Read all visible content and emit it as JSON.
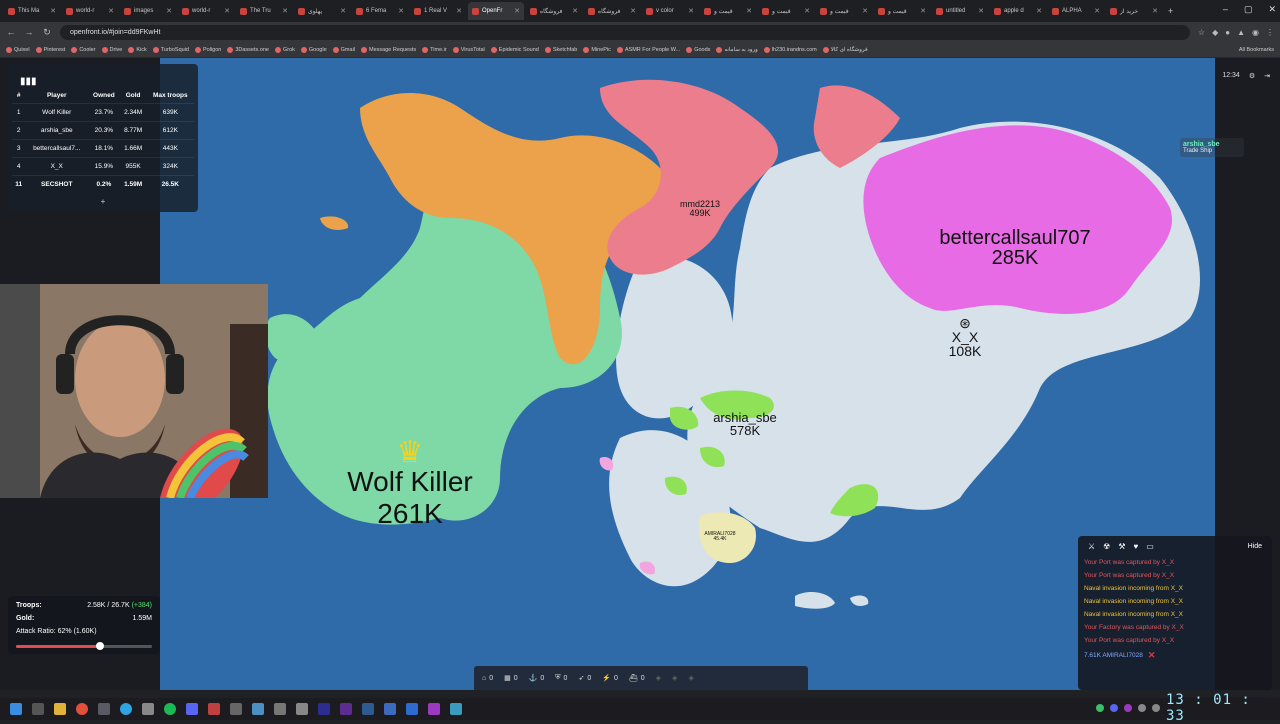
{
  "browser": {
    "tabs": [
      "This Ma",
      "world-r",
      "images",
      "world-r",
      "The Tru",
      "پهلوی",
      "6 Fema",
      "1 Real V",
      "OpenFr",
      "فروشگاه",
      "فروشگاه",
      "v color",
      "قیمت و",
      "قیمت و",
      "قیمت و",
      "قیمت و",
      "untitled",
      "apple d",
      "ALPHA",
      "خرید از"
    ],
    "active_tab_index": 8,
    "url": "openfront.io/#join=dd9FKwHt",
    "bookmarks": [
      "Quixel",
      "Pinterest",
      "Cooler",
      "Drive",
      "Kick",
      "TurboSquid",
      "Poligon",
      "3Dassets.one",
      "Grok",
      "Google",
      "Gmail",
      "Message Requests",
      "Time.ir",
      "VirusTotal",
      "Epidemic Sound",
      "Sketchfab",
      "MinePic",
      "ASMR For People W...",
      "Goods",
      "ورود به سامانه",
      "lh230.irandns.com",
      "فروشگاه ای کالا"
    ],
    "all_bookmarks": "All Bookmarks"
  },
  "leaderboard": {
    "headers": [
      "#",
      "Player",
      "Owned",
      "Gold",
      "Max troops"
    ],
    "rows": [
      [
        "1",
        "Wolf Killer",
        "23.7%",
        "2.34M",
        "639K"
      ],
      [
        "2",
        "arshia_sbe",
        "20.3%",
        "8.77M",
        "612K"
      ],
      [
        "3",
        "bettercallsaul7...",
        "18.1%",
        "1.66M",
        "443K"
      ],
      [
        "4",
        "X_X",
        "15.9%",
        "955K",
        "324K"
      ],
      [
        "11",
        "SECSHOT",
        "0.2%",
        "1.59M",
        "26.5K"
      ]
    ],
    "expand": "+"
  },
  "top_right": {
    "timer": "12:34"
  },
  "trade_ship": {
    "name": "arshia_sbe",
    "type": "Trade Ship"
  },
  "map_labels": {
    "wolf": {
      "name": "Wolf Killer",
      "troops": "261K"
    },
    "better": {
      "name": "bettercallsaul707",
      "troops": "285K"
    },
    "xx": {
      "name": "X_X",
      "troops": "108K"
    },
    "arshia": {
      "name": "arshia_sbe",
      "troops": "578K"
    },
    "mmd": {
      "name": "mmd2213",
      "troops": "499K"
    },
    "amirali": {
      "name": "AMIRALI7028",
      "troops": "45.4K"
    }
  },
  "stats": {
    "troops_label": "Troops:",
    "troops_value": "2.58K / 26.7K",
    "troops_rate": "(+384)",
    "gold_label": "Gold:",
    "gold_value": "1.59M",
    "attack_ratio": "Attack Ratio: 62% (1.60K)",
    "attack_ratio_fraction": 0.62
  },
  "events": {
    "hide": "Hide",
    "messages": [
      {
        "text": "Your Port was captured by X_X",
        "color": "red"
      },
      {
        "text": "Your Port was captured by X_X",
        "color": "red"
      },
      {
        "text": "Naval invasion incoming from X_X",
        "color": "yellow"
      },
      {
        "text": "Naval invasion incoming from X_X",
        "color": "yellow"
      },
      {
        "text": "Naval invasion incoming from X_X",
        "color": "yellow"
      },
      {
        "text": "Your Factory was captured by X_X",
        "color": "red"
      },
      {
        "text": "Your Port was captured by X_X",
        "color": "red"
      }
    ],
    "attack": "7.61K AMIRALI7028"
  },
  "build_bar": {
    "counts": [
      "0",
      "0",
      "0",
      "0",
      "0",
      "0",
      "0"
    ]
  },
  "clock": "13 : 01 : 33",
  "colors": {
    "ocean": "#2e6ba8",
    "wolf": "#7ed9a6",
    "orange": "#eba24a",
    "red": "#ec7d8c",
    "magenta": "#e76be4",
    "neutral": "#d7e1ea",
    "arshia": "#8fe257",
    "paleyellow": "#ece9b4"
  }
}
